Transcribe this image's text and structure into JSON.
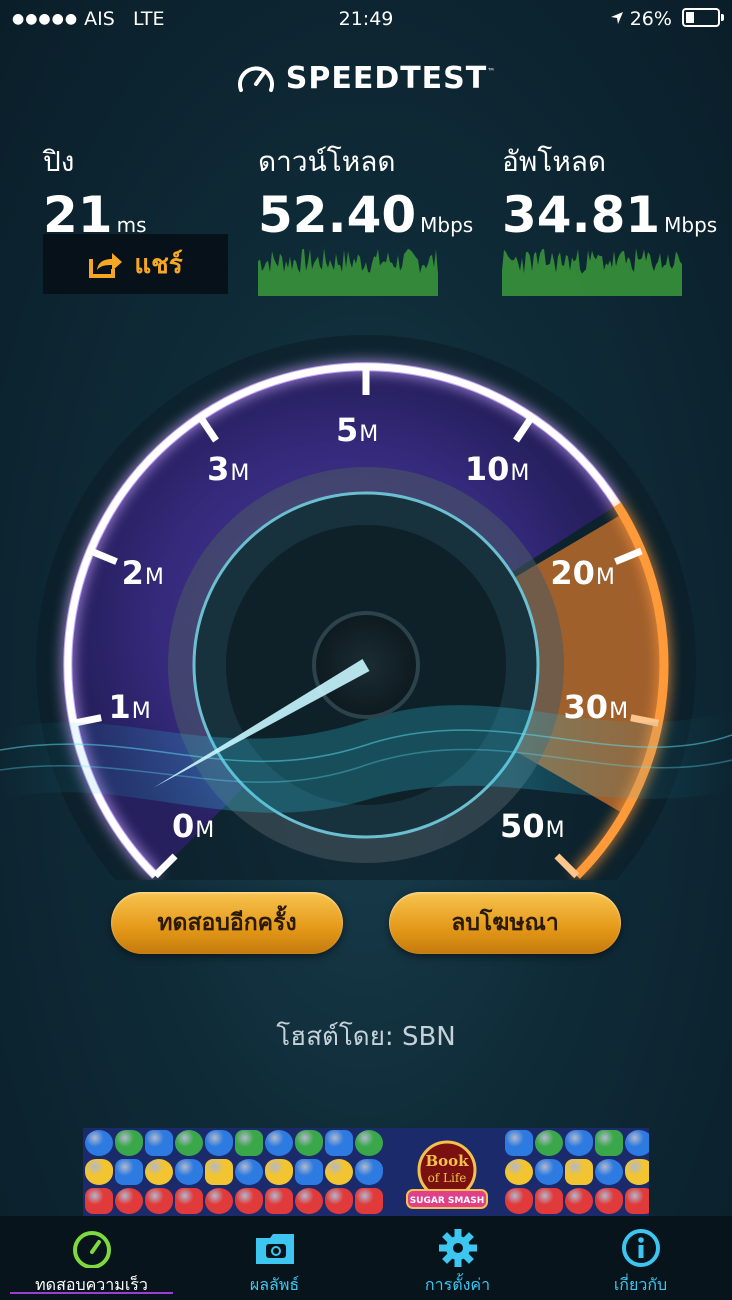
{
  "status_bar": {
    "signal_dots": "●●●●●",
    "carrier": "AIS",
    "network": "LTE",
    "time": "21:49",
    "battery": "26%"
  },
  "app": {
    "title": "SPEEDTEST",
    "trademark": "™"
  },
  "metrics": {
    "ping": {
      "label": "ปิง",
      "value": "21",
      "unit": "ms"
    },
    "download": {
      "label": "ดาวน์โหลด",
      "value": "52.40",
      "unit": "Mbps"
    },
    "upload": {
      "label": "อัพโหลด",
      "value": "34.81",
      "unit": "Mbps"
    }
  },
  "share_label": "แชร์",
  "gauge": {
    "tick_labels": [
      {
        "num": "0",
        "unit": "M"
      },
      {
        "num": "1",
        "unit": "M"
      },
      {
        "num": "2",
        "unit": "M"
      },
      {
        "num": "3",
        "unit": "M"
      },
      {
        "num": "5",
        "unit": "M"
      },
      {
        "num": "10",
        "unit": "M"
      },
      {
        "num": "20",
        "unit": "M"
      },
      {
        "num": "30",
        "unit": "M"
      },
      {
        "num": "50",
        "unit": "M"
      }
    ],
    "colors": {
      "track": "#ffffff",
      "glow_purple": "#b070ff",
      "glow_orange": "#ff8a1e",
      "needle": "#bff4ff"
    }
  },
  "buttons": {
    "retest": "ทดสอบอีกครั้ง",
    "remove_ads": "ลบโฆษณา"
  },
  "host": "โฮสต์โดย: SBN",
  "ad": {
    "title_line1": "Book",
    "title_line2": "of Life",
    "subtitle": "SUGAR SMASH"
  },
  "tabs": [
    {
      "label": "ทดสอบความเร็ว",
      "icon": "speedometer-icon"
    },
    {
      "label": "ผลลัพธ์",
      "icon": "folder-icon"
    },
    {
      "label": "การตั้งค่า",
      "icon": "gear-icon"
    },
    {
      "label": "เกี่ยวกับ",
      "icon": "info-icon"
    }
  ]
}
